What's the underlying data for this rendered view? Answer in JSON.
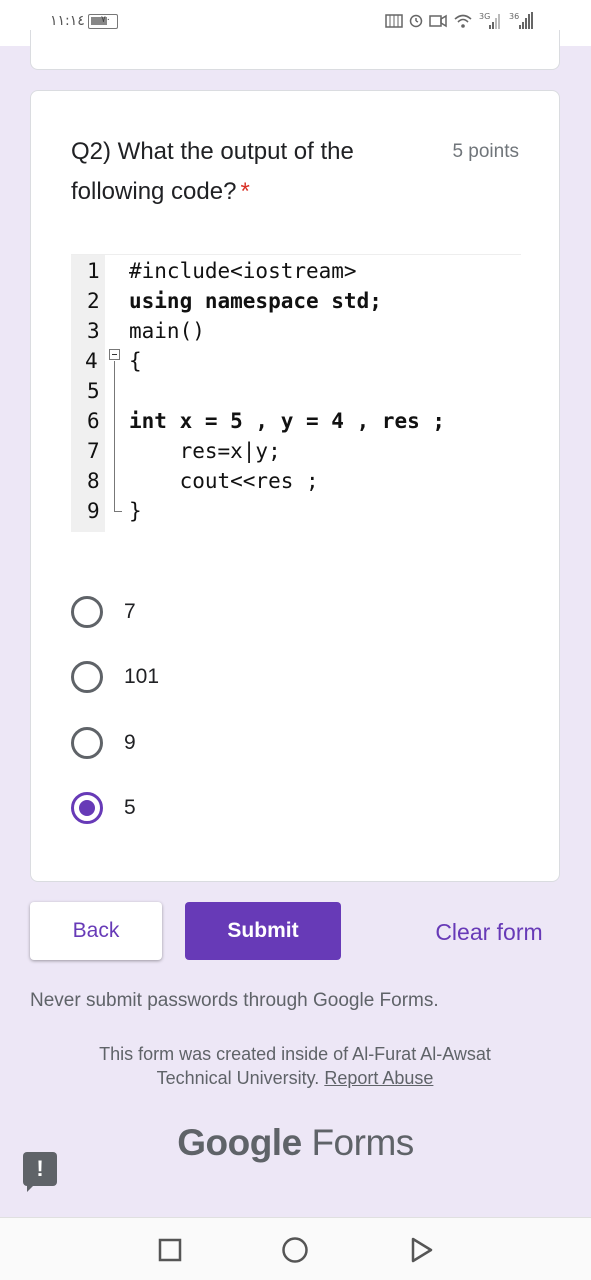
{
  "status_bar": {
    "time": "١١:١٤",
    "battery": "٧٠",
    "battery_fraction": 0.7,
    "network_1": "3G",
    "network_2": "36"
  },
  "question": {
    "title": "Q2) What the output of the following code?",
    "required_mark": "*",
    "points": "5 points",
    "code_lines": [
      {
        "num": "1",
        "text": "#include<iostream>"
      },
      {
        "num": "2",
        "text": "using namespace std;"
      },
      {
        "num": "3",
        "text": "main()"
      },
      {
        "num": "4",
        "text": "{"
      },
      {
        "num": "5",
        "text": ""
      },
      {
        "num": "6",
        "text": "int x = 5 , y = 4 , res ;"
      },
      {
        "num": "7",
        "text": "    res=x|y;"
      },
      {
        "num": "8",
        "text": "    cout<<res ;"
      },
      {
        "num": "9",
        "text": "}"
      }
    ],
    "options": [
      {
        "label": "7",
        "selected": false
      },
      {
        "label": "101",
        "selected": false
      },
      {
        "label": "9",
        "selected": false
      },
      {
        "label": "5",
        "selected": true
      }
    ]
  },
  "actions": {
    "back_label": "Back",
    "submit_label": "Submit",
    "clear_label": "Clear form"
  },
  "footer": {
    "warning": "Never submit passwords through Google Forms.",
    "created_text": "This form was created inside of Al-Furat Al-Awsat Technical University.",
    "report_link": "Report Abuse",
    "logo_google": "Google",
    "logo_forms": "Forms",
    "feedback_icon": "!"
  },
  "colors": {
    "accent": "#673ab7",
    "background": "#ede7f6",
    "required": "#d93025"
  }
}
